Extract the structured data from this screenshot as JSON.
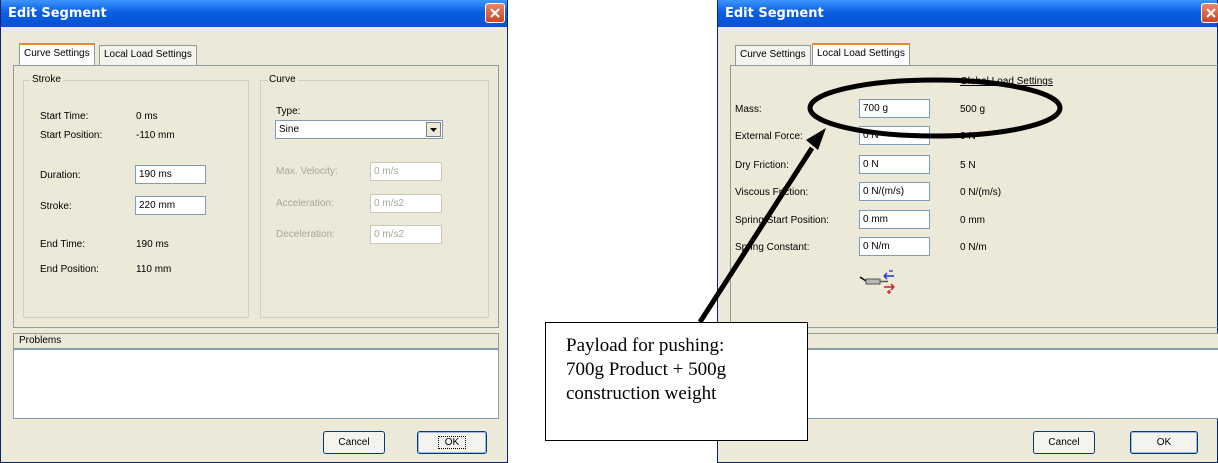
{
  "left_dialog": {
    "title": "Edit Segment",
    "tabs": [
      {
        "label": "Curve Settings",
        "hotkey": "C",
        "active": true
      },
      {
        "label": "Local Load Settings",
        "hotkey": "L",
        "active": false
      }
    ],
    "stroke_group": {
      "legend": "Stroke",
      "start_time_label": "Start Time:",
      "start_time_value": "0 ms",
      "start_position_label": "Start Position:",
      "start_position_value": "-110 mm",
      "duration_label": "Duration:",
      "duration_value": "190 ms",
      "stroke_label": "Stroke:",
      "stroke_value": "220 mm",
      "end_time_label": "End Time:",
      "end_time_value": "190 ms",
      "end_position_label": "End Position:",
      "end_position_value": "110 mm"
    },
    "curve_group": {
      "legend": "Curve",
      "type_label": "Type:",
      "type_value": "Sine",
      "max_velocity_label": "Max. Velocity:",
      "max_velocity_value": "0 m/s",
      "acceleration_label": "Acceleration:",
      "acceleration_value": "0 m/s2",
      "deceleration_label": "Deceleration:",
      "deceleration_value": "0 m/s2"
    },
    "problems_label": "Problems",
    "cancel_label": "Cancel",
    "ok_label": "OK"
  },
  "right_dialog": {
    "title": "Edit Segment",
    "tabs": [
      {
        "label": "Curve Settings",
        "active": false
      },
      {
        "label": "Local Load Settings",
        "active": true
      }
    ],
    "global_load_header": "Global Load Settings",
    "rows": [
      {
        "label": "Mass:",
        "local": "700 g",
        "global": "500 g"
      },
      {
        "label": "External Force:",
        "local": "0 N",
        "global": "0 N"
      },
      {
        "label": "Dry Friction:",
        "local": "0 N",
        "global": "5 N"
      },
      {
        "label": "Viscous Friction:",
        "local": "0 N/(m/s)",
        "global": "0 N/(m/s)"
      },
      {
        "label": "Spring Start Position:",
        "local": "0 mm",
        "global": "0 mm"
      },
      {
        "label": "Spring Constant:",
        "local": "0 N/m",
        "global": "0 N/m"
      }
    ],
    "cancel_label": "Cancel",
    "ok_label": "OK"
  },
  "callout": {
    "lines": [
      "Payload for pushing:",
      "700g Product + 500g",
      "construction weight"
    ]
  },
  "colors": {
    "titlebar": "#0453d4",
    "dialog_bg": "#ece9d8",
    "close_button": "#c8452a",
    "tab_highlight": "#e68b2c",
    "disabled_text": "#a7a69b"
  }
}
